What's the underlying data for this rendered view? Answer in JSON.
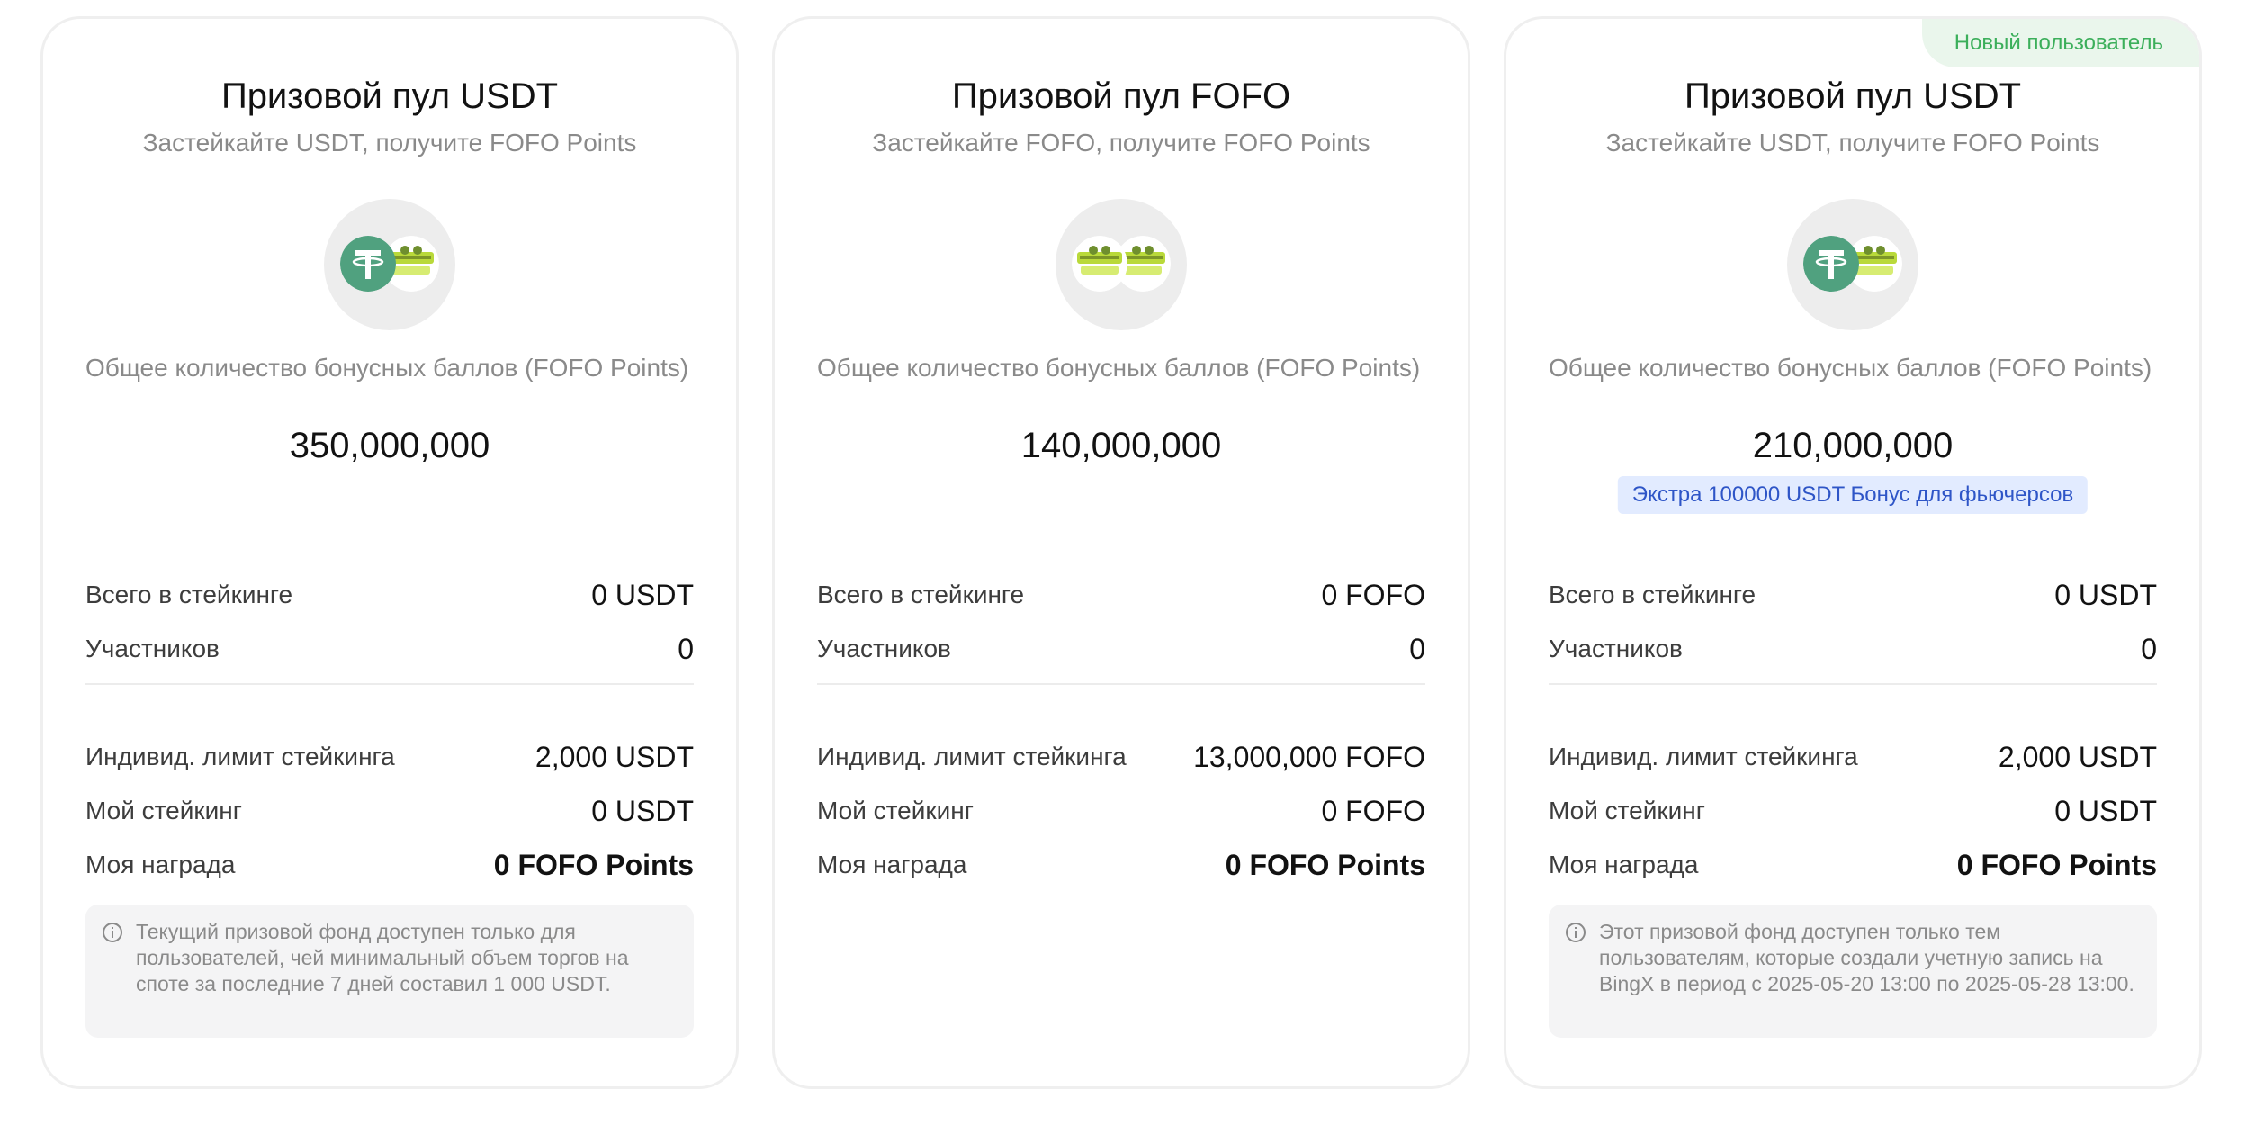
{
  "cards": [
    {
      "title": "Призовой пул USDT",
      "subtitle": "Застейкайте USDT, получите FOFO Points",
      "coins": [
        "usdt-coin-icon",
        "fofo-coin-icon"
      ],
      "total_label": "Общее количество бонусных баллов (FOFO Points)",
      "total_value": "350,000,000",
      "total_staked_label": "Всего в стейкинге",
      "total_staked_value": "0 USDT",
      "participants_label": "Участников",
      "participants_value": "0",
      "limit_label": "Индивид. лимит стейкинга",
      "limit_value": "2,000 USDT",
      "my_staking_label": "Мой стейкинг",
      "my_staking_value": "0 USDT",
      "my_reward_label": "Моя награда",
      "my_reward_value": "0 FOFO Points",
      "note": "Текущий призовой фонд доступен только для пользователей, чей минимальный объем торгов на споте за последние 7 дней составил 1 000 USDT."
    },
    {
      "title": "Призовой пул FOFO",
      "subtitle": "Застейкайте FOFO, получите FOFO Points",
      "coins": [
        "fofo-coin-icon",
        "fofo-coin-icon"
      ],
      "total_label": "Общее количество бонусных баллов (FOFO Points)",
      "total_value": "140,000,000",
      "total_staked_label": "Всего в стейкинге",
      "total_staked_value": "0 FOFO",
      "participants_label": "Участников",
      "participants_value": "0",
      "limit_label": "Индивид. лимит стейкинга",
      "limit_value": "13,000,000 FOFO",
      "my_staking_label": "Мой стейкинг",
      "my_staking_value": "0 FOFO",
      "my_reward_label": "Моя награда",
      "my_reward_value": "0 FOFO Points"
    },
    {
      "badge": "Новый пользователь",
      "title": "Призовой пул USDT",
      "subtitle": "Застейкайте USDT, получите FOFO Points",
      "coins": [
        "usdt-coin-icon",
        "fofo-coin-icon"
      ],
      "total_label": "Общее количество бонусных баллов (FOFO Points)",
      "total_value": "210,000,000",
      "extra": "Экстра 100000 USDT Бонус для фьючерсов",
      "total_staked_label": "Всего в стейкинге",
      "total_staked_value": "0 USDT",
      "participants_label": "Участников",
      "participants_value": "0",
      "limit_label": "Индивид. лимит стейкинга",
      "limit_value": "2,000 USDT",
      "my_staking_label": "Мой стейкинг",
      "my_staking_value": "0 USDT",
      "my_reward_label": "Моя награда",
      "my_reward_value": "0 FOFO Points",
      "note": "Этот призовой фонд доступен только тем пользователям, которые создали учетную запись на BingX в период с 2025-05-20 13:00 по 2025-05-28 13:00."
    }
  ],
  "colors": {
    "usdt": "#50a17f",
    "fofo": "#b9d93a",
    "badge_text": "#3caf5b",
    "badge_bg": "#eaf6ec",
    "extra_text": "#2e55c7",
    "extra_bg": "#e2ebff"
  }
}
